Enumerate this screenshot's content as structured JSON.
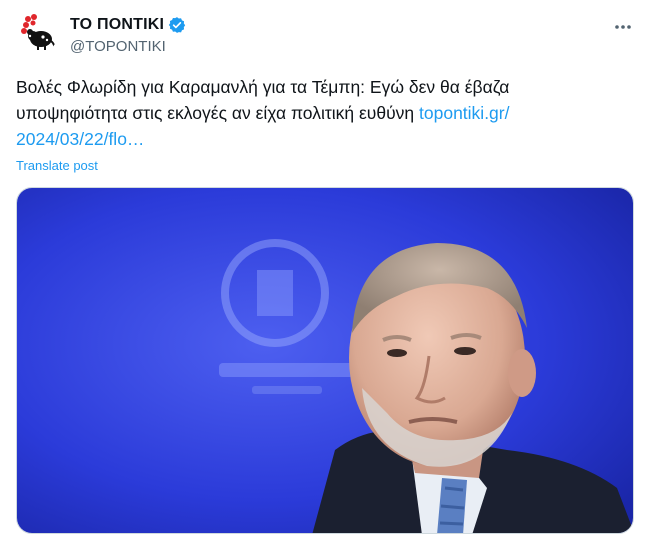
{
  "author": {
    "display_name": "ΤΟ ΠΟΝΤΙΚΙ",
    "handle": "@TOPONTIKI",
    "verified_icon": "verified-badge-icon",
    "avatar_icon": "mouse-logo-avatar"
  },
  "post": {
    "text": "Βολές Φλωρίδη για Καραμανλή για τα Τέμπη: Εγώ δεν θα έβαζα υποψηφιότητα στις εκλογές αν είχα πολιτική ευθύνη ",
    "link_text": "topontiki.gr/\n2024/03/22/flo…",
    "translate_label": "Translate post"
  },
  "media": {
    "description_icon": "press-photo"
  },
  "colors": {
    "link": "#1d9bf0",
    "secondary_text": "#536471",
    "verified": "#1d9bf0",
    "photo_background": "#2b3bd9"
  }
}
